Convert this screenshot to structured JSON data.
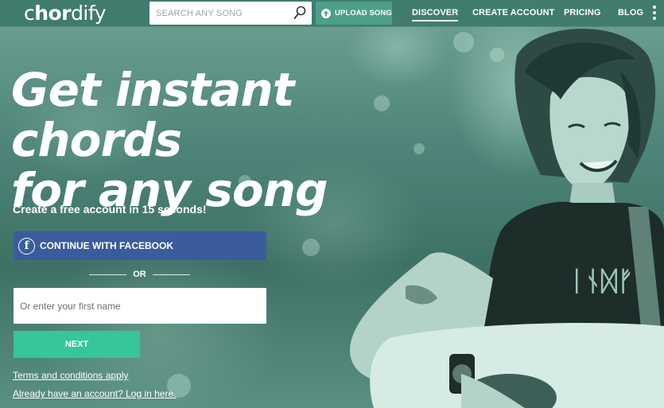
{
  "brand": {
    "logo_prefix": "c",
    "logo_bold": "hor",
    "logo_suffix": "dify"
  },
  "search": {
    "placeholder": "SEARCH ANY SONG",
    "icon": "search-icon"
  },
  "upload": {
    "label": "UPLOAD SONG",
    "icon": "upload-icon"
  },
  "nav": {
    "discover": "DISCOVER",
    "create_account": "CREATE ACCOUNT",
    "pricing": "PRICING",
    "blog": "BLOG",
    "more_icon": "more-vertical-icon"
  },
  "hero": {
    "headline_line1": "Get instant chords",
    "headline_line2": "for any song",
    "subhead": "Create a free account in 15 seconds!",
    "facebook_label": "CONTINUE WITH FACEBOOK",
    "or_label": "OR",
    "name_placeholder": "Or enter your first name",
    "next_label": "NEXT",
    "terms_link": "Terms and conditions apply",
    "login_link": "Already have an account? Log in here."
  },
  "colors": {
    "topbar": "#3d786b",
    "upload_button": "#4d9f8a",
    "facebook_button": "#3b5c9c",
    "next_button": "#35c69a"
  }
}
